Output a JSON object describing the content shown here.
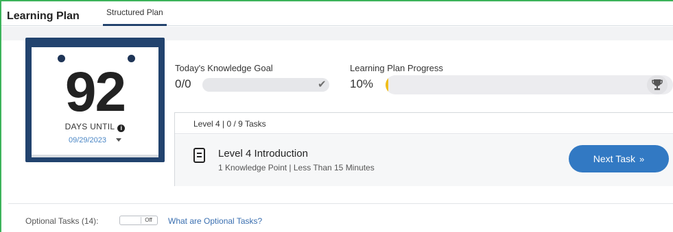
{
  "header": {
    "title": "Learning Plan",
    "tabs": [
      {
        "label": "Structured Plan",
        "active": true
      }
    ]
  },
  "countdown": {
    "days": "92",
    "days_label": "DAYS UNTIL",
    "info_icon": "info-circle-icon",
    "date": "09/29/2023"
  },
  "knowledge_goal": {
    "label": "Today's Knowledge Goal",
    "value": "0/0",
    "icon": "check-icon"
  },
  "plan_progress": {
    "label": "Learning Plan Progress",
    "value": "10%",
    "percent": 10,
    "icon": "trophy-icon"
  },
  "task_card": {
    "header": "Level 4 | 0 / 9 Tasks",
    "task_title": "Level 4 Introduction",
    "task_meta": "1 Knowledge Point |  Less Than 15 Minutes",
    "next_button": "Next Task",
    "next_icon": "double-chevron-right-icon"
  },
  "optional_tasks": {
    "label": "Optional Tasks (14):",
    "toggle_state": "Off",
    "link": "What are Optional Tasks?"
  },
  "colors": {
    "accent_blue": "#3279c3",
    "calendar_navy": "#22436e",
    "progress_yellow": "#f0be1b",
    "frame_green": "#3cb35a"
  }
}
